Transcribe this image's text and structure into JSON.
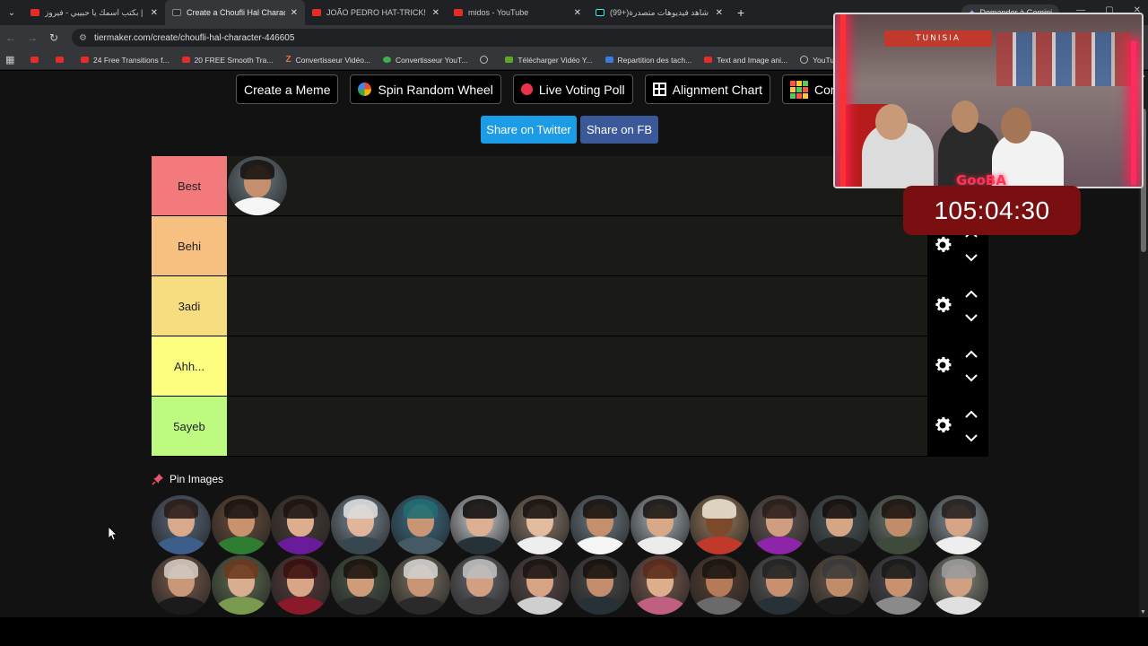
{
  "browser": {
    "tabs": [
      {
        "title": "بكتب اسمك يا حبيبي - فيروز | ube",
        "icon": "youtube-icon",
        "active": false
      },
      {
        "title": "Create a Choufli Hal Character",
        "icon": "tiermaker-icon",
        "active": true
      },
      {
        "title": "JOÃO PEDRO HAT-TRICK! | Che",
        "icon": "youtube-icon",
        "active": false
      },
      {
        "title": "midos - YouTube",
        "icon": "youtube-icon",
        "active": false
      },
      {
        "title": "(99+)شاهد فيديوهات متصدرة",
        "icon": "tiktok-icon",
        "active": false
      }
    ],
    "gemini_label": "Demander à Gemini",
    "url": "tiermaker.com/create/choufli-hal-character-446605",
    "bookmarks": [
      {
        "label": "",
        "icon": "youtube-icon"
      },
      {
        "label": "",
        "icon": "youtube-icon"
      },
      {
        "label": "24 Free Transitions f...",
        "icon": "youtube-icon"
      },
      {
        "label": "20 FREE Smooth Tra...",
        "icon": "youtube-icon"
      },
      {
        "label": "Convertisseur Vidéo...",
        "icon": "z-icon"
      },
      {
        "label": "Convertisseur YouT...",
        "icon": "g-icon"
      },
      {
        "label": "",
        "icon": "globe-icon"
      },
      {
        "label": "Télécharger Vidéo Y...",
        "icon": "download-icon"
      },
      {
        "label": "Repartition des tach...",
        "icon": "docs-icon"
      },
      {
        "label": "Text and Image ani...",
        "icon": "youtube-icon"
      },
      {
        "label": "YouTube Converter...",
        "icon": "globe-icon"
      }
    ]
  },
  "toolbar": {
    "buttons": [
      {
        "label": "Create a Meme",
        "icon": ""
      },
      {
        "label": "Spin Random Wheel",
        "icon": "wheel-icon"
      },
      {
        "label": "Live Voting Poll",
        "icon": "record-dot-icon"
      },
      {
        "label": "Alignment Chart",
        "icon": "grid-icon"
      },
      {
        "label": "Comp",
        "icon": "compare-grid-icon"
      }
    ]
  },
  "share": {
    "twitter": "Share on Twitter",
    "facebook": "Share on FB"
  },
  "tiers": [
    {
      "label": "Best",
      "color": "#f27a7d",
      "items": 1
    },
    {
      "label": "Behi",
      "color": "#f7bf80",
      "items": 0
    },
    {
      "label": "3adi",
      "color": "#f6de80",
      "items": 0
    },
    {
      "label": "Ahh...",
      "color": "#fdfe7f",
      "items": 0
    },
    {
      "label": "5ayeb",
      "color": "#bdfa7f",
      "items": 0
    }
  ],
  "pin_images_label": "Pin Images",
  "pool_count": 28,
  "stream": {
    "banner_text": "TUNISIA",
    "neon_text": "GooBA",
    "timer": "105:04:30"
  },
  "colors": {
    "page_bg": "#121212",
    "tier_row_bg": "#1a1a17",
    "twitter": "#1c9be6",
    "facebook": "#3b5998",
    "timer_bg": "#7a0f12"
  }
}
